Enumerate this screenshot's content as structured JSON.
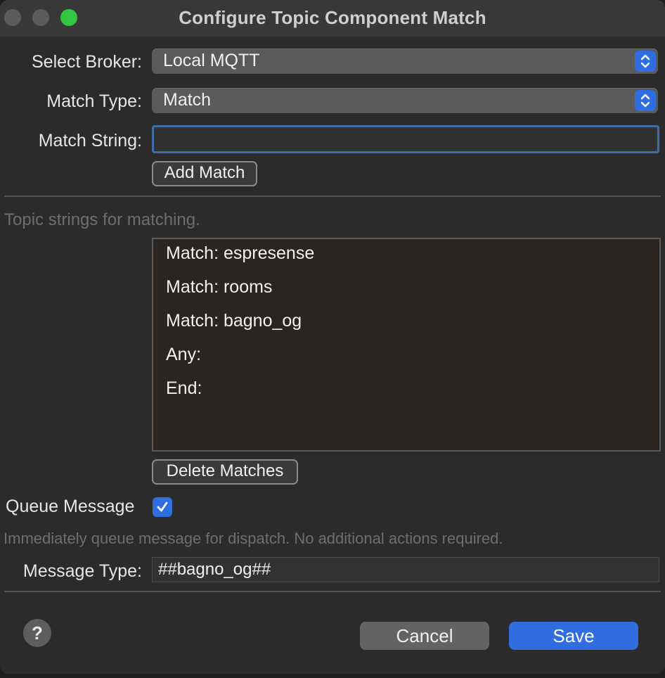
{
  "window": {
    "title": "Configure Topic Component Match"
  },
  "form": {
    "broker_label": "Select Broker:",
    "broker_value": "Local MQTT",
    "match_type_label": "Match Type:",
    "match_type_value": "Match",
    "match_string_label": "Match String:",
    "match_string_value": "",
    "add_match_label": "Add Match"
  },
  "matches": {
    "hint": "Topic strings for matching.",
    "items": [
      "Match: espresense",
      "Match: rooms",
      "Match: bagno_og",
      "Any:",
      "End:"
    ],
    "delete_label": "Delete Matches"
  },
  "queue": {
    "label": "Queue Message",
    "checked": true,
    "hint": "Immediately queue message for dispatch.  No additional actions required."
  },
  "message_type": {
    "label": "Message Type:",
    "value": "##bagno_og##"
  },
  "footer": {
    "help_label": "?",
    "cancel_label": "Cancel",
    "save_label": "Save"
  },
  "colors": {
    "accent": "#2f6de1",
    "traffic_zoom": "#31c740"
  },
  "icons": {
    "stepper": "up-down-chevron-icon",
    "checkbox": "checkmark-icon"
  }
}
